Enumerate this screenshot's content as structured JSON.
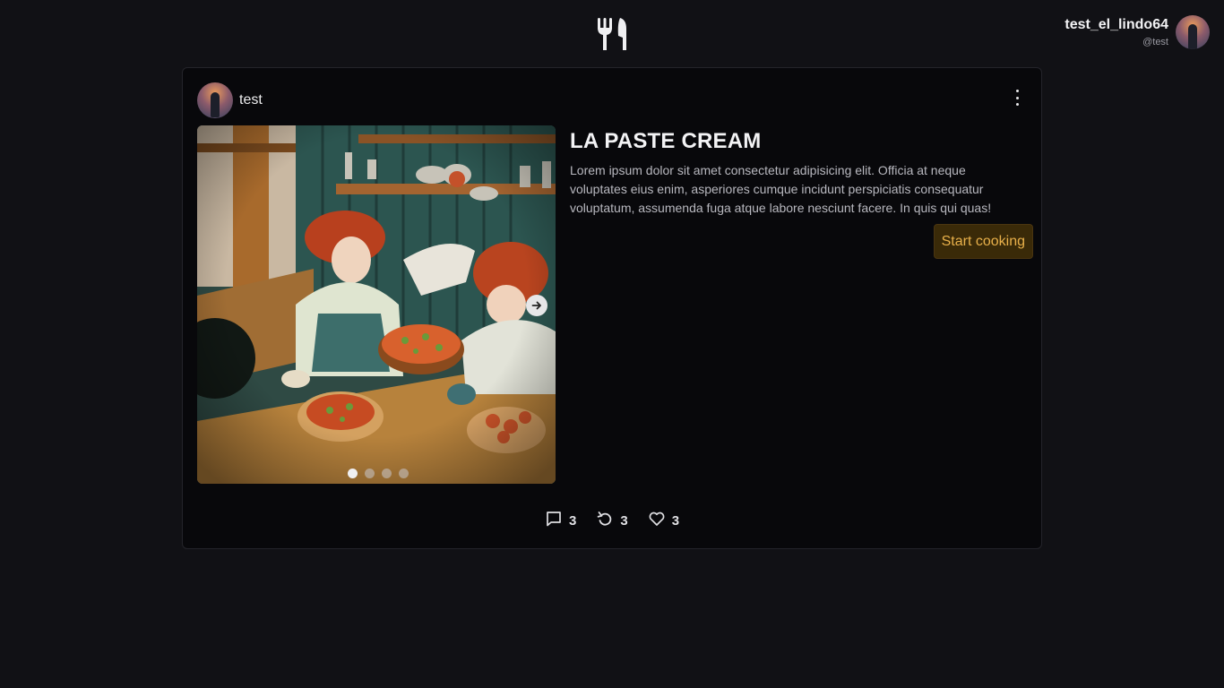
{
  "header": {
    "logo_icon": "fork-knife-icon",
    "user": {
      "display_name": "test_el_lindo64",
      "handle": "@test",
      "avatar_icon": "avatar"
    }
  },
  "post": {
    "author": {
      "name": "test",
      "avatar_icon": "avatar"
    },
    "menu_icon": "more-vertical-icon",
    "media": {
      "slide_count": 4,
      "active_slide": 1,
      "next_icon": "arrow-right-icon"
    },
    "title": "LA PASTE CREAM",
    "description": "Lorem ipsum dolor sit amet consectetur adipisicing elit. Officia at neque voluptates eius enim, asperiores cumque incidunt perspiciatis consequatur voluptatum, assumenda fuga atque labore nesciunt facere. In quis qui quas!",
    "start_button_label": "Start cooking",
    "stats": {
      "comments": "3",
      "reposts": "3",
      "likes": "3"
    }
  },
  "colors": {
    "background": "#111115",
    "card": "#08080b",
    "accent_text": "#e8b04a",
    "accent_bg": "#3a2a08"
  }
}
